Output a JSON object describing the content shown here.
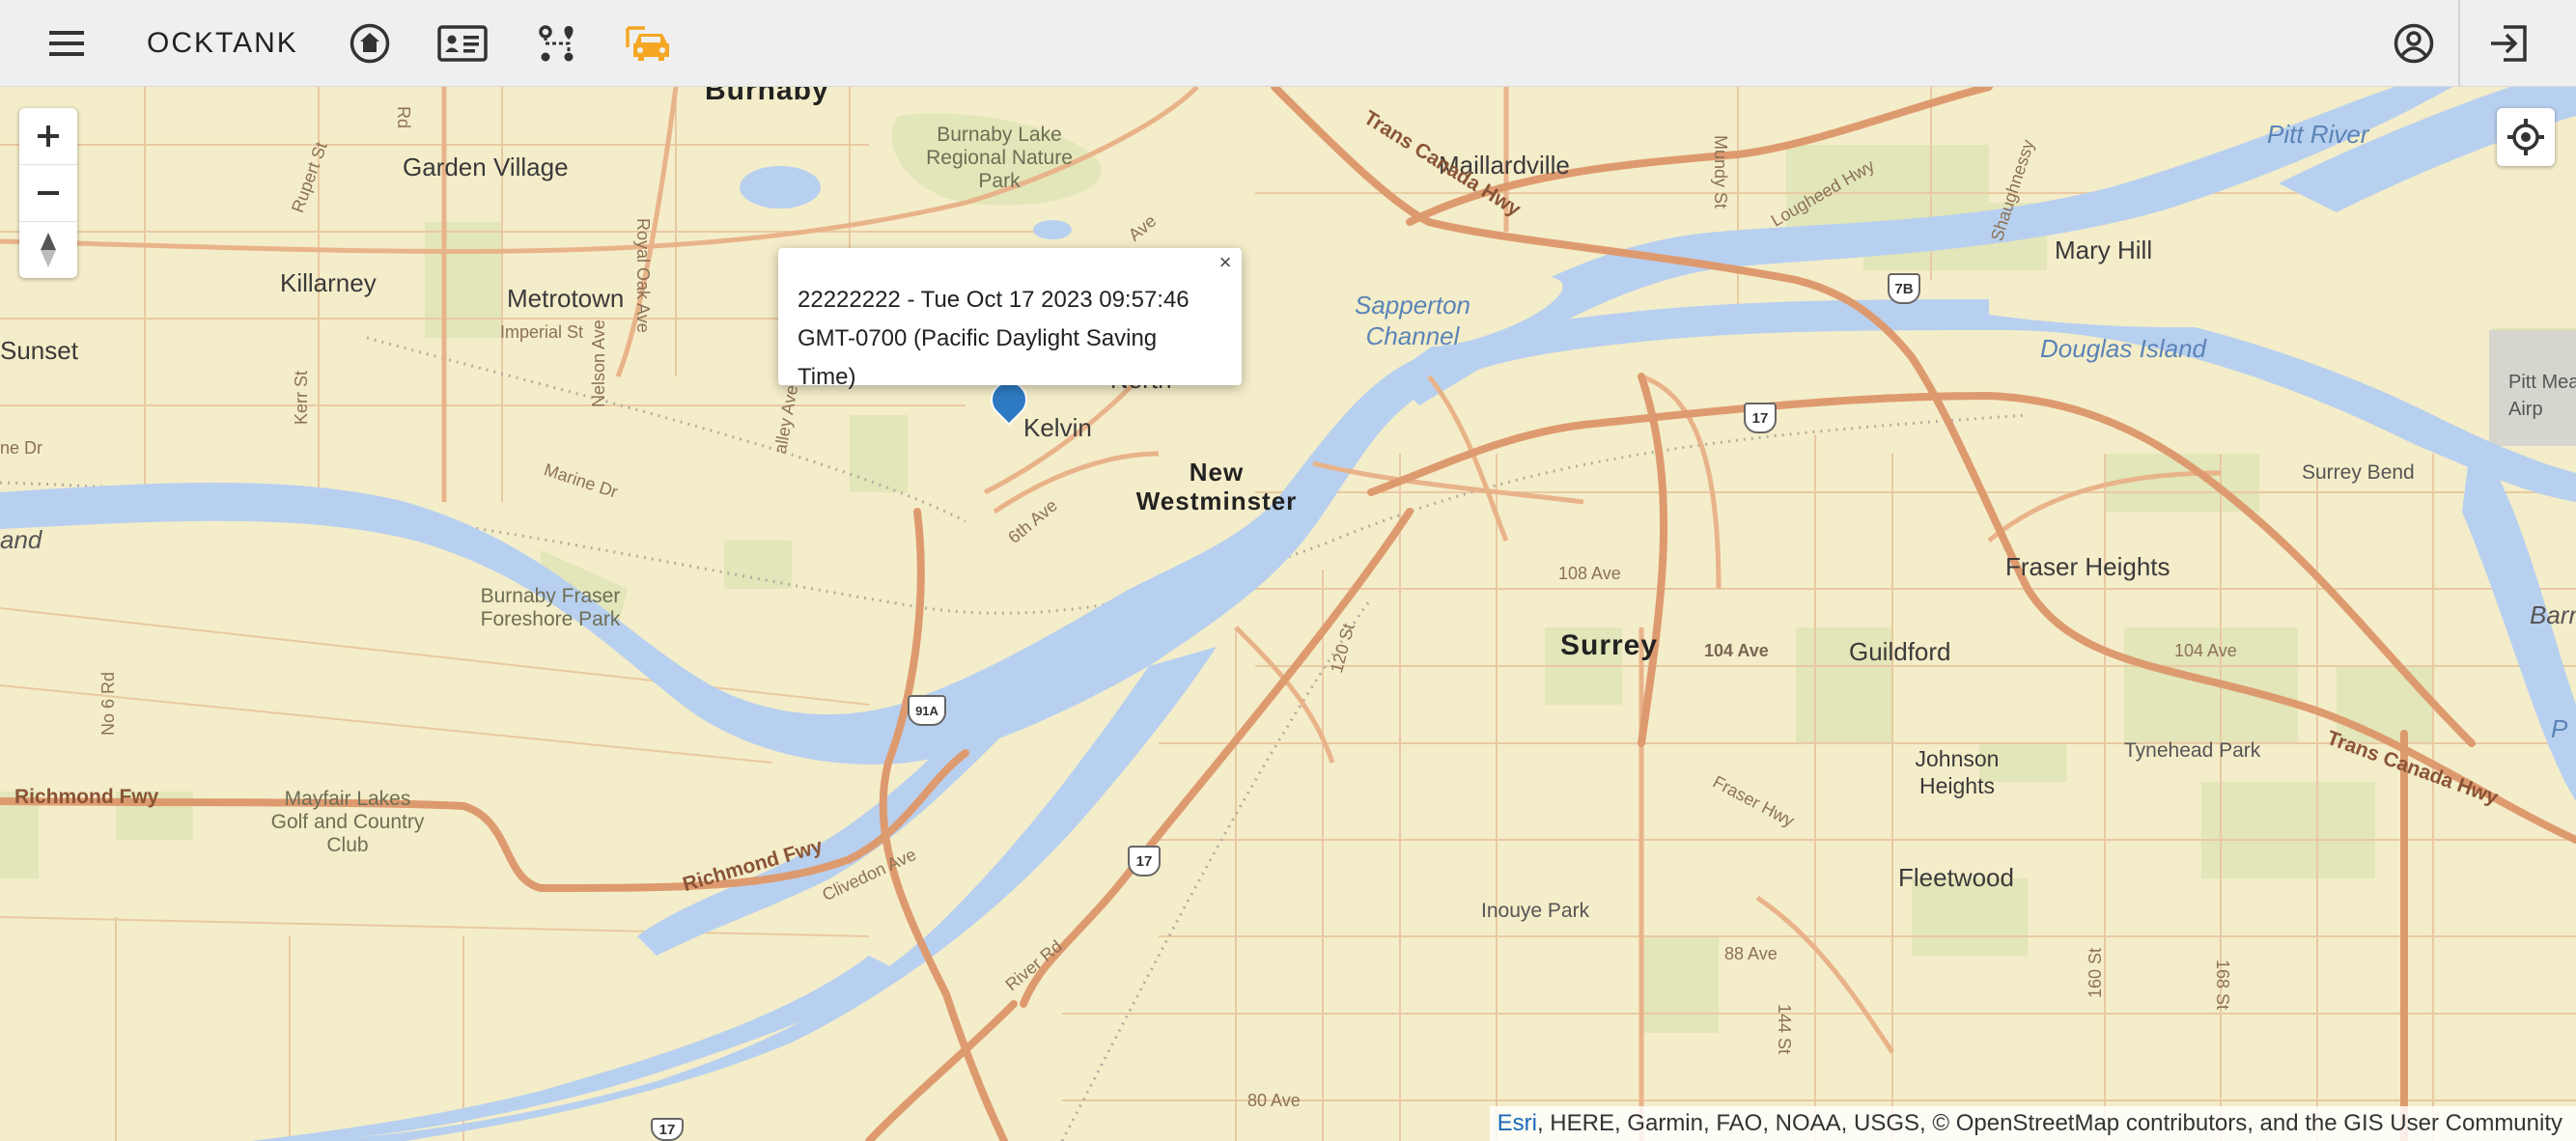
{
  "app": {
    "brand": "OCKTANK"
  },
  "colors": {
    "accent": "#f5a623",
    "water": "#b8d0ef",
    "land": "#f4edc9",
    "marker": "#2e7ac2",
    "major_road": "#de9a6f"
  },
  "toolbar": {
    "icons": [
      "menu-icon",
      "home-icon",
      "id-card-icon",
      "route-icon",
      "car-icon",
      "account-icon",
      "logout-icon"
    ],
    "active": "car-icon"
  },
  "map": {
    "controls": {
      "zoom_in": "+",
      "zoom_out": "−",
      "compass": "▲"
    },
    "popup": {
      "line1": "22222222 - Tue Oct 17 2023 09:57:46",
      "line2": "GMT-0700 (Pacific Daylight Saving Time)",
      "close": "×"
    },
    "labels": {
      "burnaby": "Burnaby",
      "garden_village": "Garden Village",
      "burnaby_lake_park": "Burnaby Lake Regional Nature Park",
      "maillardville": "Maillardville",
      "pitt_river": "Pitt River",
      "killarney": "Killarney",
      "metrotown": "Metrotown",
      "imperial_st": "Imperial St",
      "sunset": "Sunset",
      "mary_hill": "Mary Hill",
      "sapperton_channel": "Sapperton Channel",
      "douglas_island": "Douglas Island",
      "pitt_meadows_airport": "Pitt Mea Airp",
      "north": "North",
      "kelvin": "Kelvin",
      "new_westminster": "New Westminster",
      "marine_dr": "Marine Dr",
      "surrey_bend": "Surrey Bend",
      "burnaby_fraser_foreshore_park": "Burnaby Fraser Foreshore Park",
      "fraser_heights": "Fraser Heights",
      "surrey": "Surrey",
      "ave_104": "104 Ave",
      "ave_104_east": "104 Ave",
      "guildford": "Guildford",
      "ave_108": "108 Ave",
      "barn": "Barn",
      "richmond_fwy": "Richmond Fwy",
      "richmond_fwy_2": "Richmond Fwy",
      "mayfair_lakes": "Mayfair Lakes Golf and Country Club",
      "johnson_heights": "Johnson Heights",
      "tynehead_park": "Tynehead Park",
      "trans_canada_hwy": "Trans Canada Hwy",
      "trans_canada_hwy_2": "Trans Canada Hwy",
      "fraser_hwy": "Fraser Hwy",
      "fleetwood": "Fleetwood",
      "inouye_park": "Inouye Park",
      "ave_88": "88 Ave",
      "ave_80": "80 Ave",
      "river_rd": "River Rd",
      "clivedon_ave": "Clivedon Ave",
      "lougheed_hwy": "Lougheed Hwy",
      "nelson_ave": "Nelson Ave",
      "royal_oak_ave": "Royal Oak Ave",
      "kerr_st": "Kerr St",
      "rupert_st": "Rupert St",
      "sixth_ave": "6th Ave",
      "ave_top": "Ave",
      "no6_rd": "No 6 Rd",
      "st_120": "120 St",
      "st_144": "144 St",
      "st_160": "160 St",
      "st_168": "168 St",
      "mundy_st": "Mundy St",
      "shaughnessy": "Shaughnessy",
      "and_fragment": "and",
      "ne_dr": "ne Dr",
      "rd_fragment": "Rd",
      "valley_ave": "alley Ave",
      "p_fragment": "P"
    },
    "shields": {
      "h7b": "7B",
      "h17a": "17",
      "h17b": "17",
      "h91a": "91A",
      "h17c": "17"
    },
    "attribution": {
      "link": "Esri",
      "text": ", HERE, Garmin, FAO, NOAA, USGS, © OpenStreetMap contributors, and the GIS User Community"
    }
  }
}
